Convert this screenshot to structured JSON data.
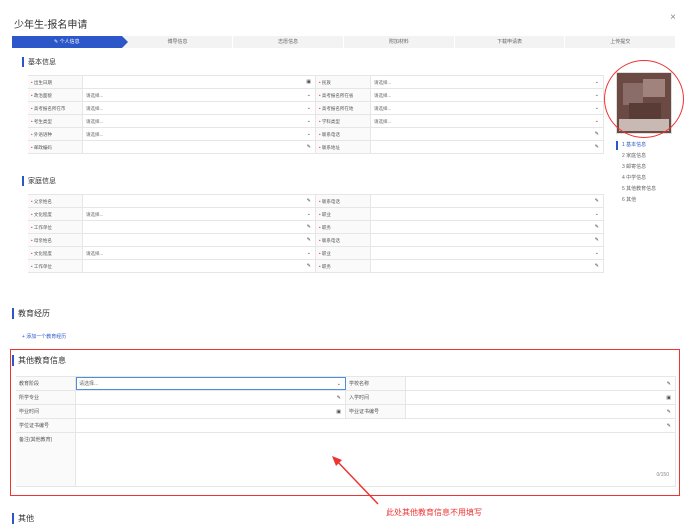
{
  "modal": {
    "title": "少年生-报名申请",
    "close": "×"
  },
  "steps": [
    "个人信息",
    "博导信息",
    "志愿信息",
    "附加材料",
    "下载申请表",
    "上传提交"
  ],
  "basic": {
    "title": "基本信息",
    "rows": [
      [
        {
          "label": "出生日期",
          "value": "",
          "icon": "calendar-icon"
        },
        {
          "label": "民族",
          "value": "请选择...",
          "icon": "dropdown-icon"
        }
      ],
      [
        {
          "label": "政治面貌",
          "value": "请选择...",
          "icon": "dropdown-icon"
        },
        {
          "label": "高考报名所在省",
          "value": "请选择...",
          "icon": "dropdown-icon"
        }
      ],
      [
        {
          "label": "高考报名所在市",
          "value": "请选择...",
          "icon": "dropdown-icon"
        },
        {
          "label": "高考报名所在地",
          "value": "请选择...",
          "icon": "dropdown-icon"
        }
      ],
      [
        {
          "label": "考生类型",
          "value": "请选择...",
          "icon": "dropdown-icon"
        },
        {
          "label": "学科类型",
          "value": "请选择...",
          "icon": "dropdown-icon"
        }
      ],
      [
        {
          "label": "外语语种",
          "value": "请选择...",
          "icon": "dropdown-icon"
        },
        {
          "label": "联系电话",
          "value": "",
          "icon": "edit-icon"
        }
      ],
      [
        {
          "label": "邮政编码",
          "value": "",
          "icon": "edit-icon"
        },
        {
          "label": "联系地址",
          "value": "",
          "icon": "edit-icon"
        }
      ]
    ]
  },
  "family": {
    "title": "家庭信息",
    "rows": [
      [
        {
          "label": "父亲姓名",
          "value": "",
          "icon": "edit-icon"
        },
        {
          "label": "联系电话",
          "value": "",
          "icon": "edit-icon"
        }
      ],
      [
        {
          "label": "文化程度",
          "value": "请选择...",
          "icon": "dropdown-icon"
        },
        {
          "label": "职业",
          "value": "",
          "icon": "dropdown-icon"
        }
      ],
      [
        {
          "label": "工作单位",
          "value": "",
          "icon": "edit-icon"
        },
        {
          "label": "职务",
          "value": "",
          "icon": "edit-icon"
        }
      ],
      [
        {
          "label": "母亲姓名",
          "value": "",
          "icon": "edit-icon"
        },
        {
          "label": "联系电话",
          "value": "",
          "icon": "edit-icon"
        }
      ],
      [
        {
          "label": "文化程度",
          "value": "请选择...",
          "icon": "dropdown-icon"
        },
        {
          "label": "职业",
          "value": "",
          "icon": "dropdown-icon"
        }
      ],
      [
        {
          "label": "工作单位",
          "value": "",
          "icon": "edit-icon"
        },
        {
          "label": "职务",
          "value": "",
          "icon": "edit-icon"
        }
      ]
    ]
  },
  "sidenav": [
    "1  基本信息",
    "2  家庭信息",
    "3  邮寄信息",
    "4  中学信息",
    "5  其他教育信息",
    "6  其他"
  ],
  "education": {
    "title": "教育经历",
    "add_link": "+ 添加一个教育经历"
  },
  "other_edu": {
    "title": "其他教育信息",
    "rows": [
      [
        {
          "label": "教育阶段",
          "value": "请选择...",
          "icon": "dropdown-icon"
        },
        {
          "label": "学校名称",
          "value": "",
          "icon": "edit-icon"
        }
      ],
      [
        {
          "label": "所学专业",
          "value": "",
          "icon": "edit-icon"
        },
        {
          "label": "入学时间",
          "value": "",
          "icon": "calendar-icon"
        }
      ],
      [
        {
          "label": "毕业时间",
          "value": "",
          "icon": "calendar-icon"
        },
        {
          "label": "毕业证书编号",
          "value": "",
          "icon": "edit-icon"
        }
      ],
      [
        {
          "label": "学位证书编号",
          "value": "",
          "icon": "edit-icon"
        }
      ]
    ],
    "remark_label": "备注(其他教育)",
    "counter": "0/150"
  },
  "annotation": "此处其他教育信息不用填写",
  "other": {
    "title": "其他"
  },
  "colors": {
    "accent": "#2b57c8",
    "annotation": "#e33333"
  }
}
